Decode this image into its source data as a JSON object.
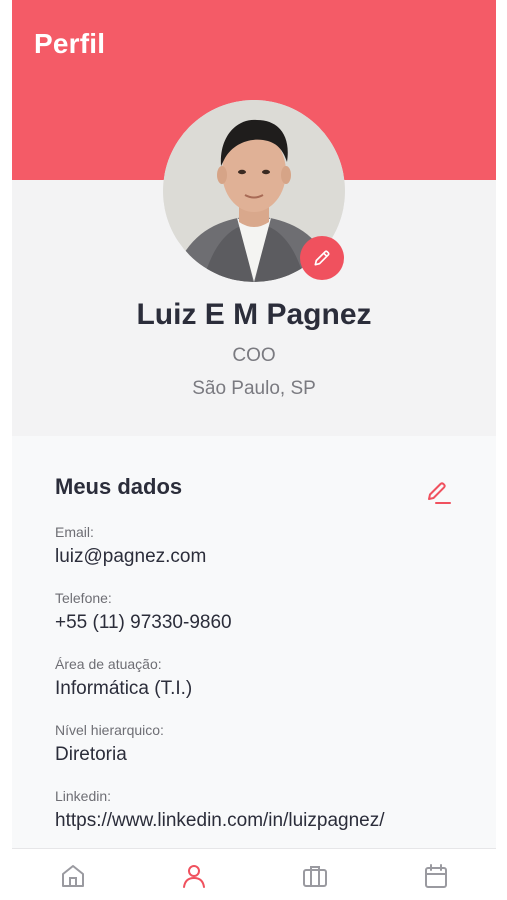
{
  "header": {
    "title": "Perfil",
    "color": "#f45b67"
  },
  "profile": {
    "name": "Luiz E M Pagnez",
    "role": "COO",
    "location": "São Paulo, SP",
    "avatar_icon": "user-photo",
    "edit_icon": "pencil-icon"
  },
  "my_data": {
    "title": "Meus dados",
    "edit_icon": "pencil-icon",
    "fields": [
      {
        "label": "Email:",
        "value": "luiz@pagnez.com"
      },
      {
        "label": "Telefone:",
        "value": "+55 (11) 97330-9860"
      },
      {
        "label": "Área de atuação:",
        "value": "Informática (T.I.)"
      },
      {
        "label": "Nível hierarquico:",
        "value": "Diretoria"
      },
      {
        "label": "Linkedin:",
        "value": "https://www.linkedin.com/in/luizpagnez/"
      }
    ]
  },
  "tabbar": {
    "items": [
      {
        "icon": "home-icon",
        "active": false
      },
      {
        "icon": "user-icon",
        "active": true
      },
      {
        "icon": "briefcase-icon",
        "active": false
      },
      {
        "icon": "calendar-icon",
        "active": false
      }
    ],
    "active_color": "#f0515e",
    "inactive_color": "#9a9aa0"
  }
}
